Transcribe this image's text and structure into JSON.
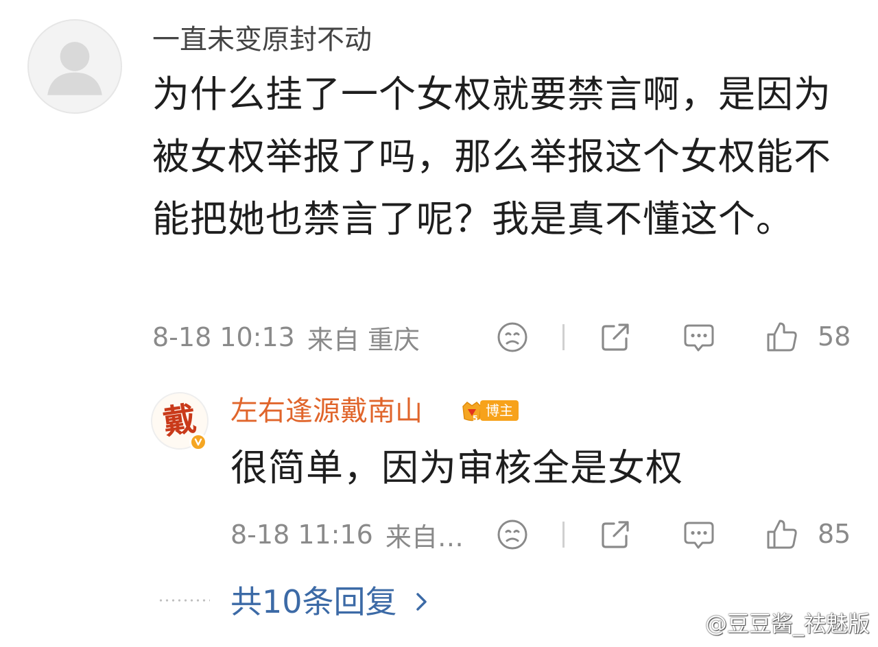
{
  "main_comment": {
    "username": "一直未变原封不动",
    "text": "为什么挂了一个女权就要禁言啊，是因为被女权举报了吗，那么举报这个女权能不能把她也禁言了呢？我是真不懂这个。",
    "date": "8-18 10:13",
    "source": "来自 重庆",
    "likes": "58",
    "icons": [
      "default-avatar-icon",
      "sad-face-icon",
      "share-icon",
      "comment-icon",
      "thumbs-up-icon"
    ]
  },
  "reply": {
    "username": "左右逢源戴南山",
    "avatar_glyph": "戴",
    "level": "5",
    "badge": "博主",
    "text": "很简单，因为审核全是女权",
    "date": "8-18 11:16",
    "source": "来自…",
    "likes": "85"
  },
  "more_replies": {
    "label": "共10条回复"
  },
  "watermark": {
    "text": "@豆豆酱_祛魅版"
  },
  "colors": {
    "username_reply": "#e0652b",
    "link": "#3c6aa6",
    "meta": "#8a8a8a",
    "badge": "#f7a21b"
  }
}
